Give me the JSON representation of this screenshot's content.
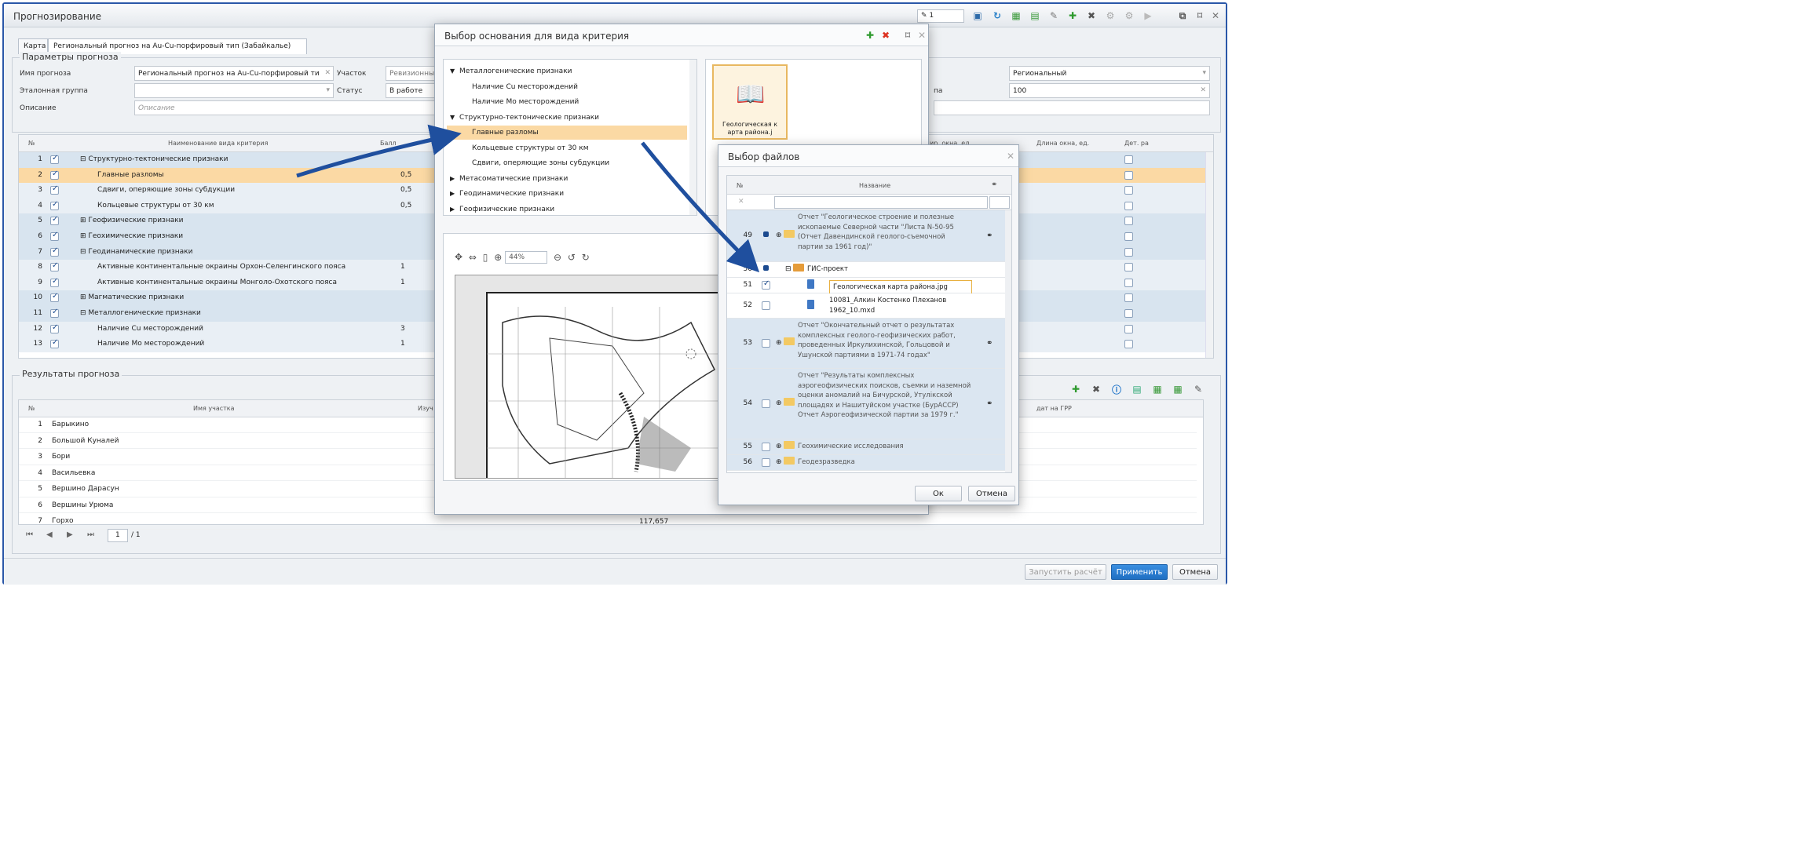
{
  "window": {
    "title": "Прогнозирование",
    "counter": "1"
  },
  "tabs": [
    {
      "label": "Карта"
    },
    {
      "label": "Региональный прогноз на Au-Cu-порфировый тип (Забайкалье)"
    }
  ],
  "params": {
    "group_title": "Параметры прогноза",
    "name_label": "Имя прогноза",
    "name_value": "Региональный прогноз на Au-Cu-порфировый ти",
    "area_label": "Участок",
    "area_value": "Ревизионны",
    "etalon_label": "Эталонная группа",
    "status_label": "Статус",
    "status_value": "В работе",
    "desc_label": "Описание",
    "desc_placeholder": "Описание",
    "right_partial_label": "па",
    "type_value": "Региональный",
    "num_value": "100"
  },
  "criteria_grid": {
    "headers": [
      "№",
      "Наименование вида критерия",
      "Балл",
      "ир. окна, ед.",
      "Длина окна, ед.",
      "Дет. ра"
    ],
    "rows": [
      {
        "n": "1",
        "name": "⊟ Структурно-тектонические признаки",
        "score": "",
        "group": true
      },
      {
        "n": "2",
        "name": "Главные разломы",
        "score": "0,5",
        "selected": true
      },
      {
        "n": "3",
        "name": "Сдвиги, оперяющие зоны субдукции",
        "score": "0,5"
      },
      {
        "n": "4",
        "name": "Кольцевые структуры от 30 км",
        "score": "0,5"
      },
      {
        "n": "5",
        "name": "⊞ Геофизические признаки",
        "score": "",
        "group": true
      },
      {
        "n": "6",
        "name": "⊞ Геохимические признаки",
        "score": "",
        "group": true
      },
      {
        "n": "7",
        "name": "⊟ Геодинамические признаки",
        "score": "",
        "group": true
      },
      {
        "n": "8",
        "name": "Активные континентальные окраины Орхон-Селенгинского пояса",
        "score": "1"
      },
      {
        "n": "9",
        "name": "Активные континентальные окраины Монголо-Охотского пояса",
        "score": "1"
      },
      {
        "n": "10",
        "name": "⊞ Магматические признаки",
        "score": "",
        "group": true
      },
      {
        "n": "11",
        "name": "⊟ Металлогенические признаки",
        "score": "",
        "group": true
      },
      {
        "n": "12",
        "name": "Наличие Cu месторождений",
        "score": "3"
      },
      {
        "n": "13",
        "name": "Наличие Mo месторождений",
        "score": "1"
      }
    ]
  },
  "results": {
    "group_title": "Результаты прогноза",
    "headers": [
      "№",
      "Имя участка",
      "Изуч",
      "дат на ГРР"
    ],
    "rows": [
      {
        "n": "1",
        "name": "Барыкино"
      },
      {
        "n": "2",
        "name": "Большой Куналей"
      },
      {
        "n": "3",
        "name": "Бори"
      },
      {
        "n": "4",
        "name": "Васильевка"
      },
      {
        "n": "5",
        "name": "Вершино Дарасун"
      },
      {
        "n": "6",
        "name": "Вершины Урюма"
      },
      {
        "n": "7",
        "name": "Горхо"
      }
    ],
    "partial_value": "117,657",
    "pager_page": "1",
    "pager_total": "/ 1"
  },
  "criteria_dialog": {
    "title": "Выбор основания для вида критерия",
    "tree": [
      {
        "label": "Металлогенические признаки",
        "level": 0,
        "expanded": true
      },
      {
        "label": "Наличие Cu месторождений",
        "level": 1
      },
      {
        "label": "Наличие Mo месторождений",
        "level": 1
      },
      {
        "label": "Структурно-тектонические признаки",
        "level": 0,
        "expanded": true
      },
      {
        "label": "Главные разломы",
        "level": 1,
        "selected": true
      },
      {
        "label": "Кольцевые структуры от 30 км",
        "level": 1
      },
      {
        "label": "Сдвиги, оперяющие зоны субдукции",
        "level": 1
      },
      {
        "label": "Метасоматические признаки",
        "level": 0
      },
      {
        "label": "Геодинамические признаки",
        "level": 0
      },
      {
        "label": "Геофизические признаки",
        "level": 0
      }
    ],
    "thumb_label": "Геологическая к арта района.j",
    "zoom": "44%"
  },
  "files_dialog": {
    "title": "Выбор файлов",
    "headers": [
      "№",
      "Название"
    ],
    "rows": [
      {
        "n": "49",
        "text": "Отчет \"Геологическое строение и полезные ископаемые Северной части \"Листа N-50-95 (Отчет Давендинской геолого-съемочной партии за 1961 год)\"",
        "kind": "folder",
        "check": "partial"
      },
      {
        "n": "50",
        "text": "ГИС-проект",
        "kind": "project",
        "check": "partial"
      },
      {
        "n": "51",
        "text": "Геологическая карта района.jpg",
        "kind": "file",
        "check": "on",
        "selected": true
      },
      {
        "n": "52",
        "text": "10081_Алкин Костенко Плеханов 1962_10.mxd",
        "kind": "file",
        "check": "off"
      },
      {
        "n": "53",
        "text": "Отчет \"Окончательный отчет о результатах комплексных геолого-геофизических работ, проведенных Иркулихинской, Гольцовой и Ушунской партиями в 1971-74 годах\"",
        "kind": "folder",
        "check": "off"
      },
      {
        "n": "54",
        "text": "Отчет \"Результаты комплексных аэрогеофизических поисков, съемки и наземной оценки аномалий на Бичурской, Утулікской площадях и Нашитуйском участке (БурАССР) Отчет Аэрогеофизической партии за 1979 г.\"",
        "kind": "folder",
        "check": "off"
      },
      {
        "n": "55",
        "text": "Геохимические исследования",
        "kind": "folder",
        "check": "off"
      },
      {
        "n": "56",
        "text": "Геодезразведка",
        "kind": "folder",
        "check": "off"
      }
    ],
    "ok": "Ок",
    "cancel": "Отмена"
  },
  "footer": {
    "run": "Запустить расчёт",
    "apply": "Применить",
    "cancel": "Отмена"
  },
  "colors": {
    "accent": "#2a57a8",
    "selected_row": "#fbd9a4",
    "group_row": "#d8e4ef",
    "primary_btn": "#1f6fc3"
  }
}
